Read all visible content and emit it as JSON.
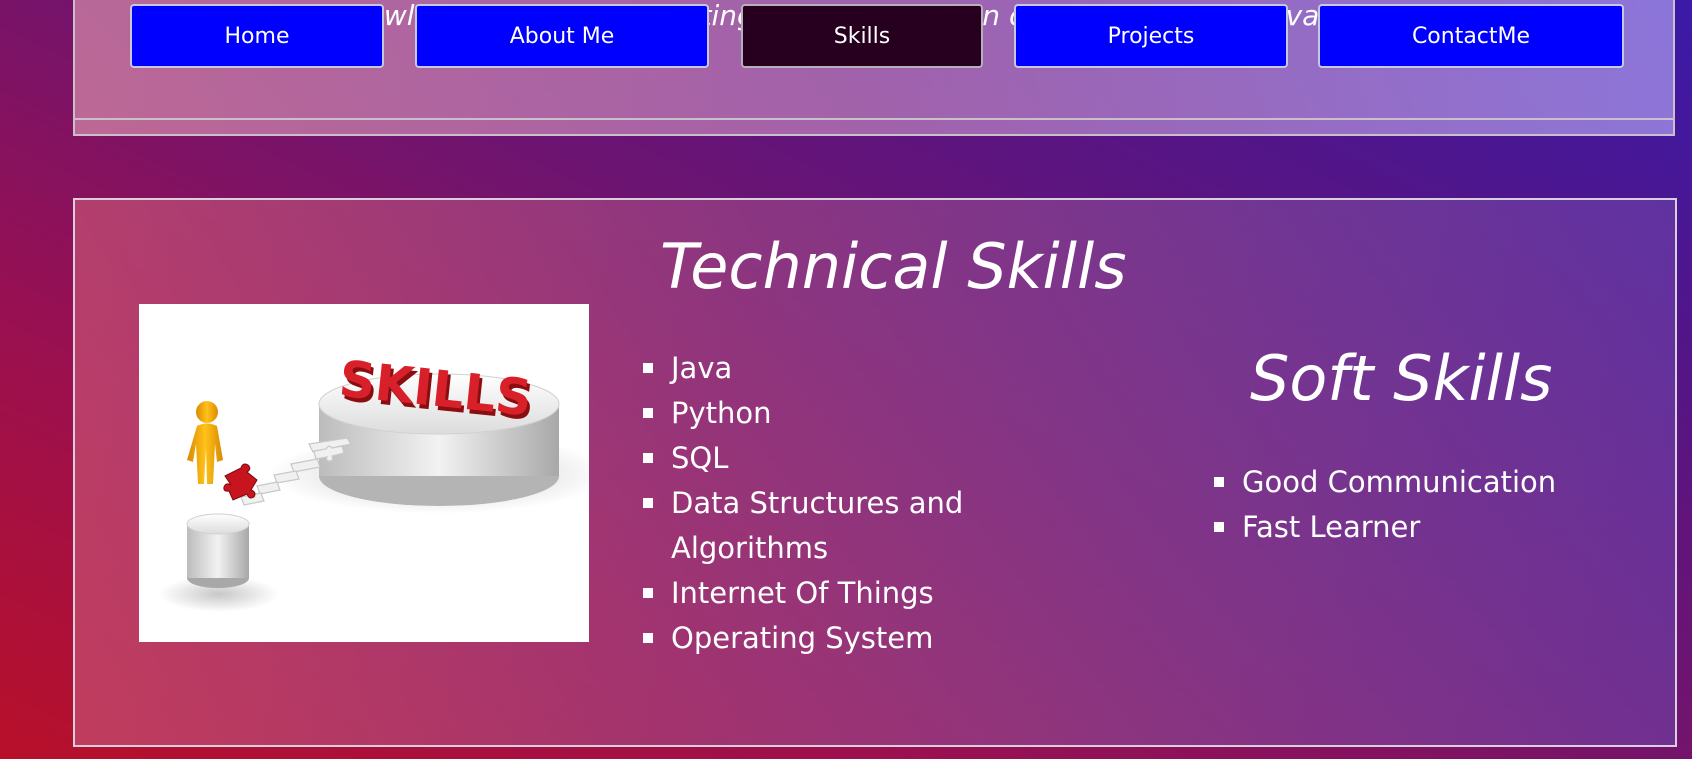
{
  "header": {
    "tagline": "theoretical knowledge in practical settings, with a focus on contributing to innovative projects."
  },
  "nav": {
    "items": [
      {
        "label": "Home"
      },
      {
        "label": "About Me"
      },
      {
        "label": "Skills"
      },
      {
        "label": "Projects"
      },
      {
        "label": "ContactMe"
      }
    ],
    "active": "Skills"
  },
  "technical": {
    "title": "Technical Skills",
    "image_text": "SKILLS",
    "items": [
      "Java",
      "Python",
      "SQL",
      "Data Structures and Algorithms",
      "Internet Of Things",
      "Operating System"
    ]
  },
  "soft": {
    "title": "Soft Skills",
    "items": [
      "Good Communication",
      "Fast Learner"
    ]
  },
  "colors": {
    "nav_button": "#0000ff",
    "nav_active": "#26001e",
    "text": "#ffffff"
  }
}
